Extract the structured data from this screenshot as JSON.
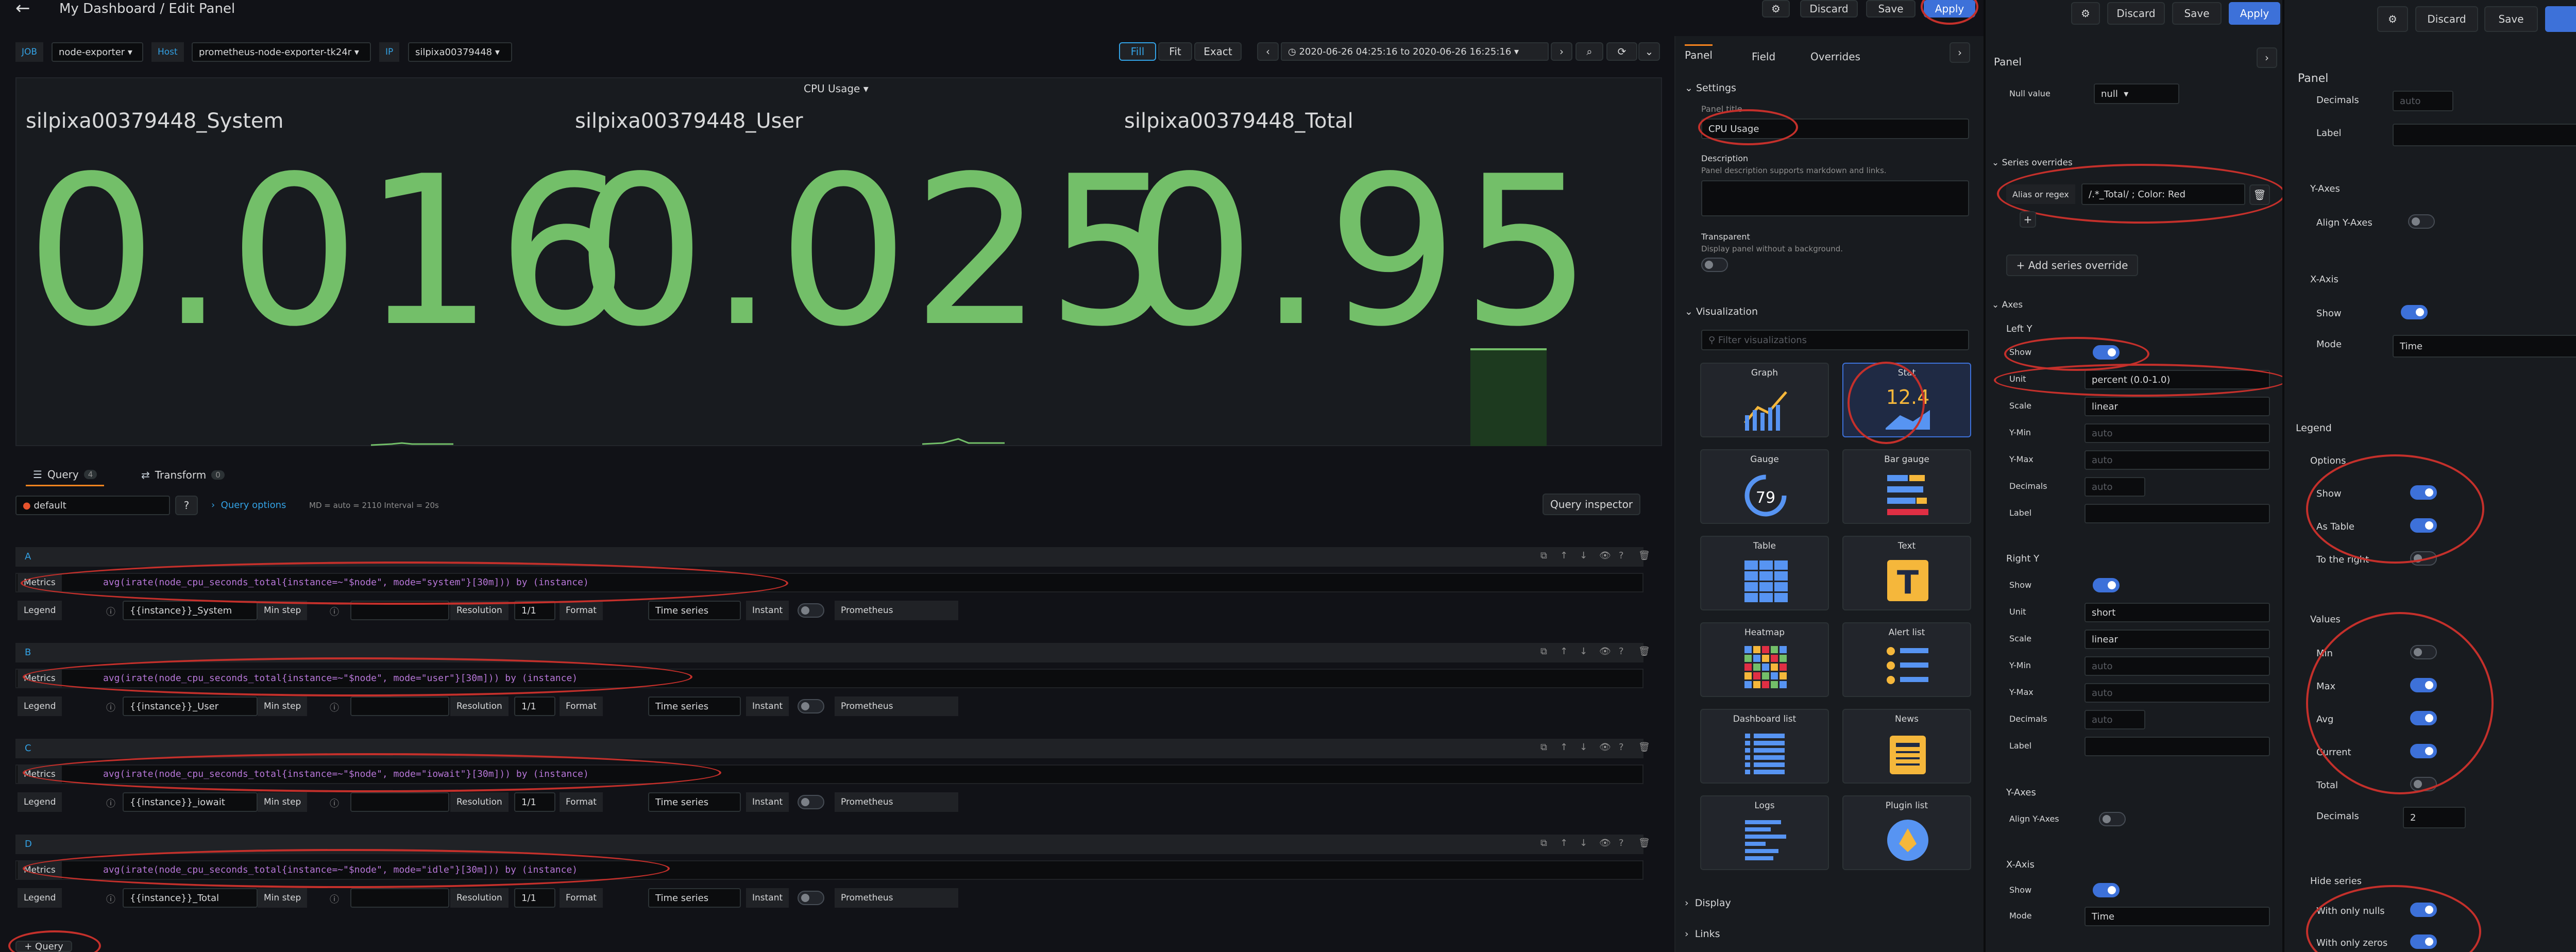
{
  "header": {
    "title": "My Dashboard / Edit Panel",
    "discard": "Discard",
    "save": "Save",
    "apply": "Apply"
  },
  "vars": {
    "job_label": "JOB",
    "job_value": "node-exporter",
    "host_label": "Host",
    "host_value": "prometheus-node-exporter-tk24r",
    "ip_label": "IP",
    "ip_value": "silpixa00379448"
  },
  "viewmodes": {
    "fill": "Fill",
    "fit": "Fit",
    "exact": "Exact"
  },
  "timerange": "2020-06-26 04:25:16 to 2020-06-26 16:25:16",
  "panel": {
    "title": "CPU Usage",
    "stats": [
      {
        "name": "silpixa00379448_System",
        "value": "0.016"
      },
      {
        "name": "silpixa00379448_User",
        "value": "0.025"
      },
      {
        "name": "silpixa00379448_Total",
        "value": "0.95"
      }
    ]
  },
  "qtabs": {
    "query": "Query",
    "query_count": "4",
    "transform": "Transform",
    "transform_count": "0"
  },
  "datasource": "default",
  "query_options": "Query options",
  "query_meta": "MD = auto = 2110   Interval = 20s",
  "query_inspector": "Query inspector",
  "queries": [
    {
      "id": "A",
      "metrics_label": "Metrics",
      "expr": "avg(irate(node_cpu_seconds_total{instance=~\"$node\", mode=\"system\"}[30m])) by (instance)",
      "legend": "{{instance}}_System"
    },
    {
      "id": "B",
      "metrics_label": "Metrics",
      "expr": "avg(irate(node_cpu_seconds_total{instance=~\"$node\", mode=\"user\"}[30m])) by (instance)",
      "legend": "{{instance}}_User"
    },
    {
      "id": "C",
      "metrics_label": "Metrics",
      "expr": "avg(irate(node_cpu_seconds_total{instance=~\"$node\", mode=\"iowait\"}[30m])) by (instance)",
      "legend": "{{instance}}_iowait"
    },
    {
      "id": "D",
      "metrics_label": "Metrics",
      "expr": "avg(irate(node_cpu_seconds_total{instance=~\"$node\", mode=\"idle\"}[30m])) by (instance)",
      "legend": "{{instance}}_Total"
    }
  ],
  "qrow_labels": {
    "legend": "Legend",
    "min_step": "Min step",
    "resolution": "Resolution",
    "resolution_val": "1/1",
    "format": "Format",
    "format_val": "Time series",
    "instant": "Instant",
    "prometheus": "Prometheus"
  },
  "add_query": "+ Query",
  "options1": {
    "tabs": [
      "Panel",
      "Field",
      "Overrides"
    ],
    "settings": "Settings",
    "panel_title_label": "Panel title",
    "panel_title": "CPU Usage",
    "description_label": "Description",
    "description_hint": "Panel description supports markdown and links.",
    "transparent_label": "Transparent",
    "transparent_hint": "Display panel without a background.",
    "visualization": "Visualization",
    "filter_placeholder": "Filter visualizations",
    "viz": [
      "Graph",
      "Stat",
      "Gauge",
      "Bar gauge",
      "Table",
      "Text",
      "Heatmap",
      "Alert list",
      "Dashboard list",
      "News",
      "Logs",
      "Plugin list"
    ],
    "stat_value": "12.4",
    "gauge_value": "79",
    "display": "Display",
    "links": "Links"
  },
  "options2": {
    "tab": "Panel",
    "null_value_label": "Null value",
    "null_value": "null",
    "series_overrides": "Series overrides",
    "alias_label": "Alias or regex",
    "alias_value": "/.*_Total/ ; Color: Red",
    "add_override": "+ Add series override",
    "axes": "Axes",
    "left_y": "Left Y",
    "show": "Show",
    "unit": "Unit",
    "unit_val": "percent (0.0-1.0)",
    "scale": "Scale",
    "scale_val": "linear",
    "ymin": "Y-Min",
    "ymax": "Y-Max",
    "decimals": "Decimals",
    "label": "Label",
    "auto": "auto",
    "right_y": "Right Y",
    "unit_r": "short",
    "y_axes": "Y-Axes",
    "align": "Align Y-Axes",
    "x_axis": "X-Axis",
    "mode": "Mode",
    "mode_val": "Time"
  },
  "options3": {
    "tab": "Panel",
    "decimals": "Decimals",
    "label": "Label",
    "auto": "auto",
    "y_axes": "Y-Axes",
    "align": "Align Y-Axes",
    "x_axis": "X-Axis",
    "show": "Show",
    "mode": "Mode",
    "mode_val": "Time",
    "legend": "Legend",
    "options": "Options",
    "as_table": "As Table",
    "to_right": "To the right",
    "values": "Values",
    "min": "Min",
    "max": "Max",
    "avg": "Avg",
    "current": "Current",
    "total": "Total",
    "decimals_val": "2",
    "hide_series": "Hide series",
    "with_nulls": "With only nulls",
    "with_zeros": "With only zeros"
  },
  "colors": {
    "accent": "#3d71d9",
    "stat_green": "#73bf69",
    "annotation_red": "#c4302b"
  }
}
